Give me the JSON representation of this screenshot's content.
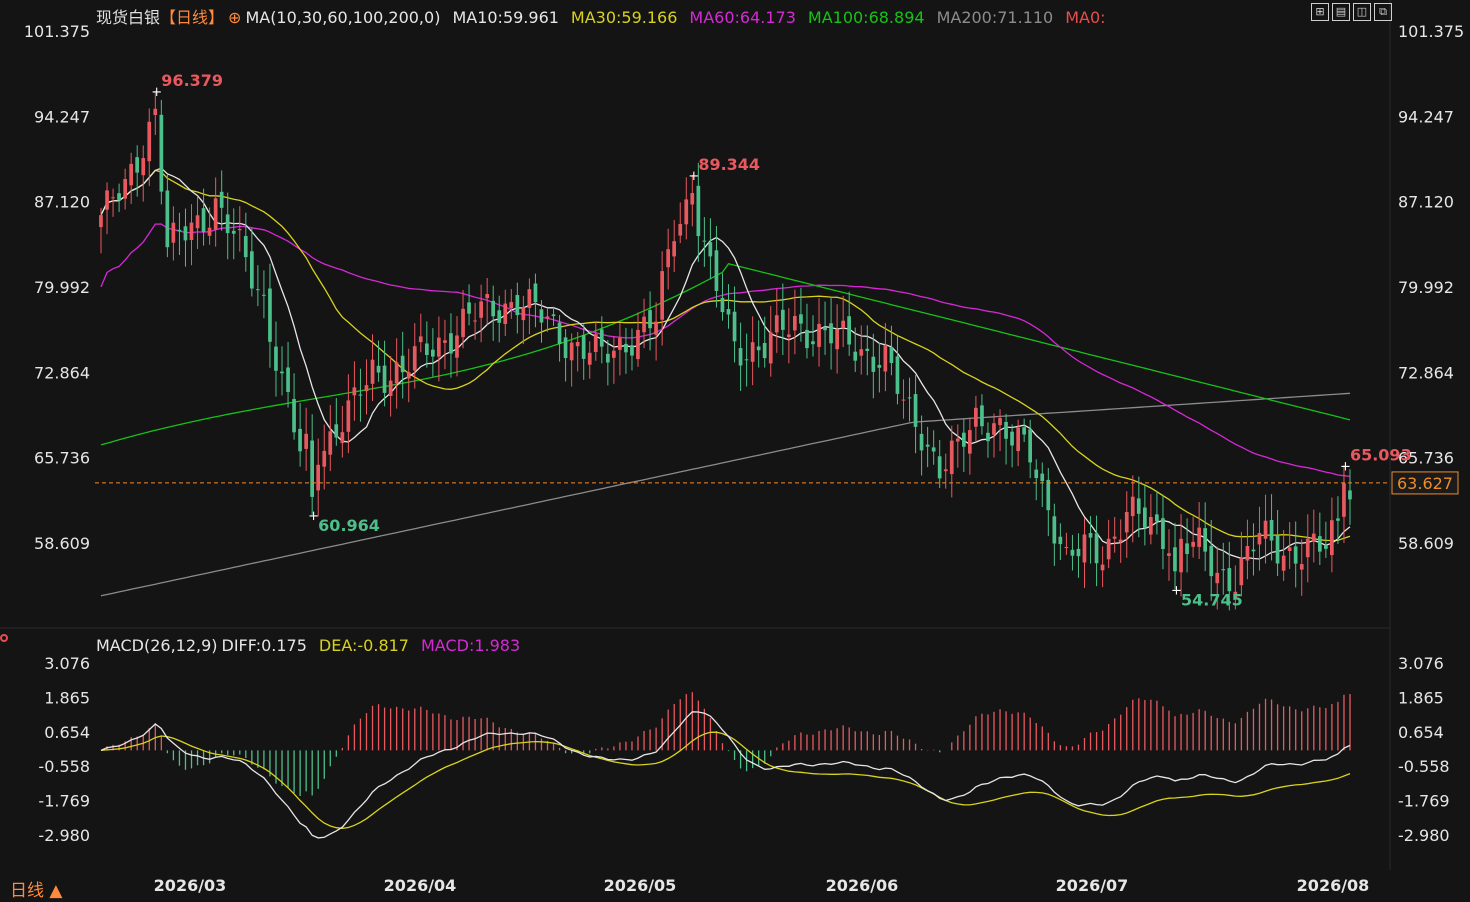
{
  "header": {
    "instrument": "现货白银",
    "period_tag": "【日线】",
    "ma_set": "MA(10,30,60,100,200,0)",
    "ma10": "MA10:59.961",
    "ma30": "MA30:59.166",
    "ma60": "MA60:64.173",
    "ma100": "MA100:68.894",
    "ma200": "MA200:71.110",
    "ma0": "MA0:"
  },
  "macd_header": {
    "name": "MACD(26,12,9)",
    "diff": "DIFF:0.175",
    "dea": "DEA:-0.817",
    "macd": "MACD:1.983"
  },
  "bottom_bar": {
    "period_label": "日线 ▲"
  },
  "colors": {
    "bg": "#141414",
    "up": "#e8595f",
    "down": "#4dbf8a",
    "ma10": "#e6e6e6",
    "ma30": "#d8d21e",
    "ma60": "#d628d6",
    "ma100": "#16c216",
    "ma200": "#8c8c8c",
    "dea": "#d8d21e",
    "current": "#f08c28"
  },
  "chart_data": {
    "type": "candlestick",
    "price_axis": {
      "range": [
        53.5,
        101.375
      ],
      "ticks": [
        "101.375",
        "94.247",
        "87.120",
        "79.992",
        "72.864",
        "65.736",
        "58.609"
      ]
    },
    "macd_axis": {
      "range": [
        -4.0,
        3.3
      ],
      "ticks": [
        "3.076",
        "1.865",
        "0.654",
        "-0.558",
        "-1.769",
        "-2.980"
      ]
    },
    "x_ticks": [
      "2026/03",
      "2026/04",
      "2026/05",
      "2026/06",
      "2026/07",
      "2026/08"
    ],
    "current_price": "63.627",
    "annotations": [
      {
        "label": "96.379",
        "value": 96.379,
        "index": 9,
        "kind": "high"
      },
      {
        "label": "60.964",
        "value": 60.964,
        "index": 35,
        "kind": "low"
      },
      {
        "label": "89.344",
        "value": 89.344,
        "index": 98,
        "kind": "high"
      },
      {
        "label": "54.745",
        "value": 54.745,
        "index": 178,
        "kind": "low"
      },
      {
        "label": "65.093",
        "value": 65.093,
        "index": 206,
        "kind": "high"
      }
    ],
    "waypoints": [
      [
        0,
        86
      ],
      [
        4,
        88
      ],
      [
        9,
        95
      ],
      [
        11,
        83
      ],
      [
        15,
        85
      ],
      [
        19,
        87
      ],
      [
        22,
        84
      ],
      [
        27,
        79
      ],
      [
        30,
        72
      ],
      [
        33,
        66
      ],
      [
        37,
        67
      ],
      [
        42,
        70
      ],
      [
        45,
        73
      ],
      [
        50,
        73
      ],
      [
        55,
        75
      ],
      [
        60,
        77
      ],
      [
        64,
        78
      ],
      [
        69,
        79
      ],
      [
        74,
        77
      ],
      [
        79,
        75
      ],
      [
        83,
        74
      ],
      [
        88,
        76
      ],
      [
        92,
        77
      ],
      [
        95,
        85
      ],
      [
        98,
        88
      ],
      [
        101,
        81
      ],
      [
        105,
        75
      ],
      [
        110,
        75
      ],
      [
        115,
        77
      ],
      [
        120,
        76
      ],
      [
        125,
        75
      ],
      [
        130,
        74
      ],
      [
        133,
        70
      ],
      [
        136,
        68
      ],
      [
        139,
        65
      ],
      [
        142,
        66
      ],
      [
        145,
        69
      ],
      [
        148,
        69
      ],
      [
        151,
        67
      ],
      [
        154,
        66
      ],
      [
        157,
        62
      ],
      [
        160,
        57
      ],
      [
        163,
        58
      ],
      [
        166,
        58
      ],
      [
        170,
        61
      ],
      [
        174,
        60
      ],
      [
        178,
        59
      ],
      [
        182,
        58
      ],
      [
        185,
        56
      ],
      [
        188,
        56
      ],
      [
        192,
        59
      ],
      [
        196,
        58
      ],
      [
        200,
        58
      ],
      [
        203,
        58
      ],
      [
        207,
        63
      ]
    ],
    "ma_endpoints": {
      "ma10": 59.961,
      "ma30": 59.166,
      "ma60": 64.173,
      "ma100": 68.894,
      "ma200": 71.11
    },
    "macd_endpoints": {
      "diff": 0.175,
      "dea": -0.817,
      "macd": 1.983
    }
  }
}
